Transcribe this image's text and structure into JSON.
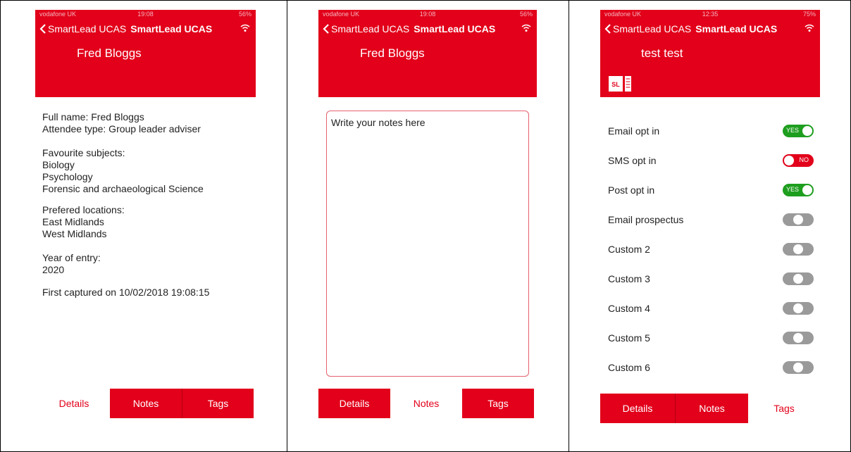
{
  "colors": {
    "brand_red": "#e2001a",
    "toggle_yes": "#1e9e1e",
    "toggle_off": "#9a9a9a",
    "notes_border": "#e5606e"
  },
  "panel1": {
    "status": {
      "carrier": "vodafone UK",
      "time": "19:08",
      "battery": "56%"
    },
    "nav": {
      "back_label": "SmartLead UCAS",
      "title": "SmartLead UCAS"
    },
    "subtitle": "Fred Bloggs",
    "details": {
      "full_name": "Full name: Fred Bloggs",
      "attendee_type": "Attendee type: Group leader adviser",
      "subjects_heading": "Favourite subjects:",
      "subjects": [
        "Biology",
        "Psychology",
        "Forensic and archaeological Science"
      ],
      "locations_heading": "Prefered locations:",
      "locations": [
        "East Midlands",
        "West Midlands"
      ],
      "year_heading": "Year of entry:",
      "year": "2020",
      "captured": "First captured on 10/02/2018 19:08:15"
    },
    "tabs": {
      "details": "Details",
      "notes": "Notes",
      "tags": "Tags"
    }
  },
  "panel2": {
    "status": {
      "carrier": "vodafone UK",
      "time": "19:08",
      "battery": "56%"
    },
    "nav": {
      "back_label": "SmartLead UCAS",
      "title": "SmartLead UCAS"
    },
    "subtitle": "Fred Bloggs",
    "notes_placeholder": "Write your notes here",
    "tabs": {
      "details": "Details",
      "notes": "Notes",
      "tags": "Tags"
    }
  },
  "panel3": {
    "status": {
      "carrier": "vodafone UK",
      "time": "12:35",
      "battery": "75%"
    },
    "nav": {
      "back_label": "SmartLead UCAS",
      "title": "SmartLead UCAS"
    },
    "icon_text": "SL",
    "subtitle": "test test",
    "tags": [
      {
        "label": "Email opt in",
        "state": "yes",
        "text": "YES"
      },
      {
        "label": "SMS opt in",
        "state": "no",
        "text": "NO"
      },
      {
        "label": "Post opt in",
        "state": "yes",
        "text": "YES"
      },
      {
        "label": "Email prospectus",
        "state": "off",
        "text": ""
      },
      {
        "label": "Custom 2",
        "state": "off",
        "text": ""
      },
      {
        "label": "Custom 3",
        "state": "off",
        "text": ""
      },
      {
        "label": "Custom 4",
        "state": "off",
        "text": ""
      },
      {
        "label": "Custom 5",
        "state": "off",
        "text": ""
      },
      {
        "label": "Custom 6",
        "state": "off",
        "text": ""
      }
    ],
    "tabs": {
      "details": "Details",
      "notes": "Notes",
      "tags": "Tags"
    }
  }
}
